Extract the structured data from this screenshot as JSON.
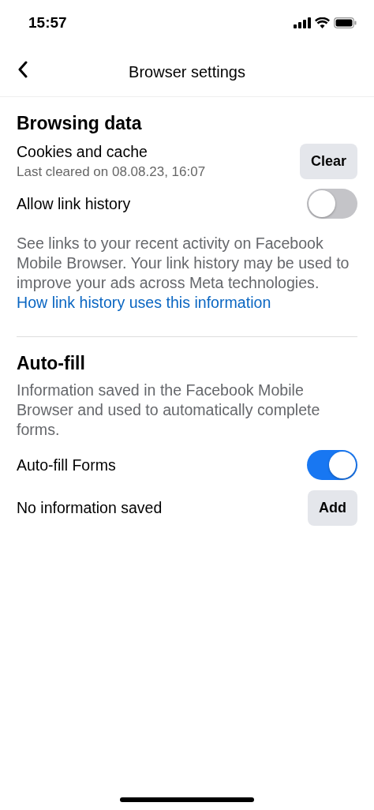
{
  "status_bar": {
    "time": "15:57"
  },
  "header": {
    "title": "Browser settings"
  },
  "sections": [
    {
      "title": "Browsing data",
      "items": [
        {
          "kind": "button",
          "label": "Cookies and cache",
          "sublabel": "Last cleared on 08.08.23, 16:07",
          "button": "Clear"
        },
        {
          "kind": "toggle",
          "label": "Allow link history",
          "on": false
        },
        {
          "kind": "note",
          "text": "See links to your recent activity on Facebook Mobile Browser. Your link history may be used to improve your ads across Meta technologies.",
          "link": [
            "How link history uses this",
            "information"
          ]
        }
      ]
    },
    {
      "title": "Auto-fill",
      "items": [
        {
          "kind": "note",
          "text": "Information saved in the Facebook Mobile Browser and used to automatically complete forms."
        },
        {
          "kind": "toggle",
          "label": "Auto-fill Forms",
          "on": true
        },
        {
          "kind": "button",
          "label": "No information saved",
          "button": "Add"
        }
      ]
    }
  ]
}
